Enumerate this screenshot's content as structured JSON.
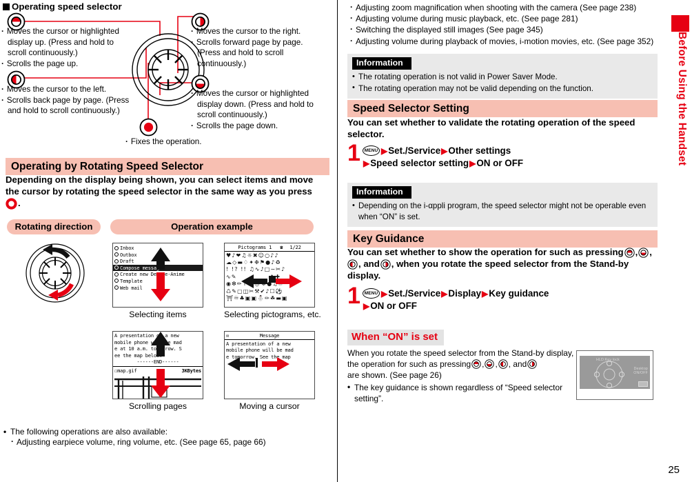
{
  "page": {
    "number": "25",
    "side_tab_label": "Before Using the Handset",
    "brand_red": "#e60012",
    "pink": "#f7bfb2",
    "gray": "#e9e9e9"
  },
  "left": {
    "diagram": {
      "heading": "Operating speed selector",
      "up_key": [
        "Moves the cursor or highlighted display up. (Press and hold to scroll continuously.)",
        "Scrolls the page up."
      ],
      "right_key": [
        "Moves the cursor to the right.",
        "Scrolls forward page by page. (Press and hold to scroll continuously.)"
      ],
      "left_key": [
        "Moves the cursor to the left.",
        "Scrolls back page by page. (Press and hold to scroll continuously.)"
      ],
      "down_key": [
        "Moves the cursor or highlighted display down. (Press and hold to scroll continuously.)",
        "Scrolls the page down."
      ],
      "center_key": [
        "Fixes the operation."
      ]
    },
    "section": {
      "title": "Operating by Rotating Speed Selector",
      "lead_a": "Depending on the display being shown, you can select items and move",
      "lead_b": "the cursor by rotating the speed selector in the same way as you press",
      "lead_c": "."
    },
    "table": {
      "col1_header": "Rotating direction",
      "col2_header": "Operation example",
      "examples": [
        {
          "caption": "Selecting items"
        },
        {
          "caption": "Selecting pictograms, etc."
        },
        {
          "caption": "Scrolling pages"
        },
        {
          "caption": "Moving a cursor"
        }
      ]
    },
    "mail_screen": {
      "rows": [
        "Inbox",
        "Outbox",
        "Draft",
        "Compose message",
        "Create new Decome-Anime",
        "Template",
        "Web mail"
      ],
      "selected_index": 3
    },
    "pictogram_screen": {
      "title": "Pictograms 1",
      "counter": "1/22"
    },
    "scroll_screen": {
      "lines": [
        "A presentation of a new",
        "mobile phone will be mad",
        "e at 10 a.m. tomorrow. S",
        "ee the map below."
      ],
      "end_marker": "------END------",
      "attachment": "map.gif",
      "size": "3KBytes"
    },
    "cursor_screen": {
      "title": "Message",
      "lines": [
        "A presentation of a new",
        "mobile phone will be mad",
        "e tomorrow. See the map"
      ]
    },
    "footnote": {
      "intro": "The following operations are also available:",
      "items": [
        "Adjusting earpiece volume, ring volume, etc. (See page 65, page 66)"
      ]
    }
  },
  "right": {
    "continued_list": [
      "Adjusting zoom magnification when shooting with the camera (See page 238)",
      "Adjusting volume during music playback, etc. (See page 281)",
      "Switching the displayed still images (See page 345)",
      "Adjusting volume during playback of movies, i-motion movies, etc. (See page 352)"
    ],
    "info1": {
      "label": "Information",
      "items": [
        "The rotating operation is not valid in Power Saver Mode.",
        "The rotating operation may not be valid depending on the function."
      ]
    },
    "speed_selector_setting": {
      "title": "Speed Selector Setting",
      "lead_a": "You can set whether to validate the rotating operation of the speed",
      "lead_b": "selector.",
      "step_number": "1",
      "menu_key": "MENU",
      "step_line1": [
        "Set./Service",
        "Other settings"
      ],
      "step_line2": [
        "Speed selector setting",
        "ON or OFF"
      ]
    },
    "info2": {
      "label": "Information",
      "items": [
        "Depending on the i-αppli program, the speed selector might not be operable even when “ON” is set."
      ]
    },
    "key_guidance": {
      "title": "Key Guidance",
      "lead_a": "You can set whether to show the operation for such as pressing",
      "lead_b": ", and",
      "lead_c": ", when you rotate the speed selector from the Stand-by",
      "lead_d": "display.",
      "step_number": "1",
      "menu_key": "MENU",
      "step_line1": [
        "Set./Service",
        "Display",
        "Key guidance"
      ],
      "step_line2": [
        "ON or OFF"
      ]
    },
    "when_on": {
      "label": "When “ON” is set",
      "text_a": "When you rotate the speed selector from the Stand-by display,",
      "text_b": "the operation for such as pressing",
      "text_c": "are shown. (See page 26)",
      "note": "The key guidance is shown regardless of “Speed selector setting”.",
      "photo": {
        "top_label": "HLD:Key lock",
        "right_label_a": "Desktop",
        "right_label_b": "ON/OFF"
      }
    }
  }
}
